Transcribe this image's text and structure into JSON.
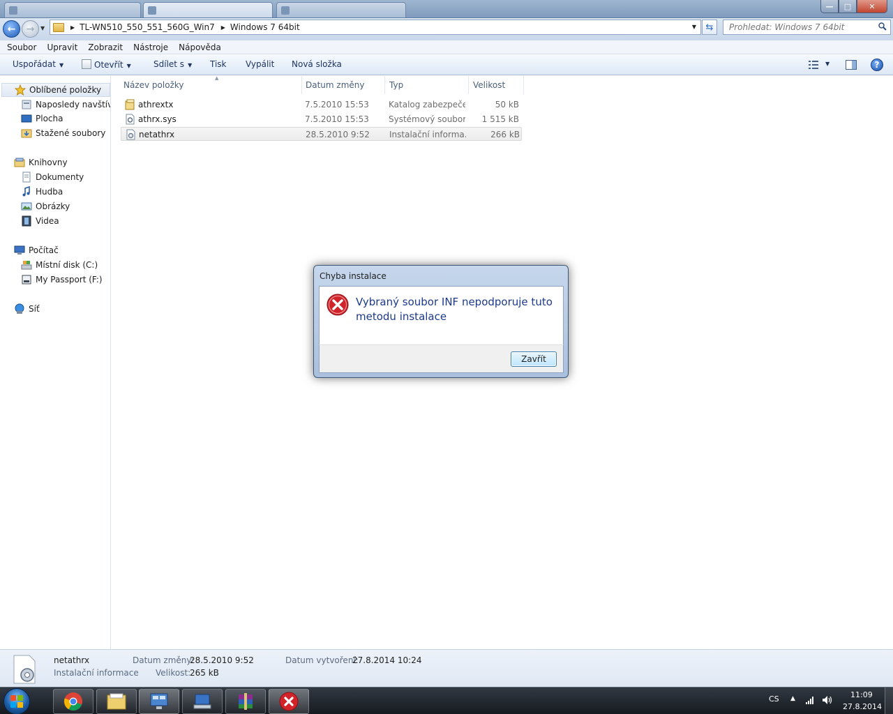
{
  "titlebar": {
    "tabs": [
      "",
      "",
      ""
    ]
  },
  "address": {
    "crumbs": [
      "TL-WN510_550_551_560G_Win7",
      "Windows 7 64bit"
    ],
    "search_placeholder": "Prohledat: Windows 7 64bit"
  },
  "menu": [
    "Soubor",
    "Upravit",
    "Zobrazit",
    "Nástroje",
    "Nápověda"
  ],
  "commands": {
    "organize": "Uspořádat",
    "open": "Otevřít",
    "share": "Sdílet s",
    "print": "Tisk",
    "burn": "Vypálit",
    "new_folder": "Nová složka"
  },
  "nav": {
    "favorites": "Oblíbené položky",
    "recent": "Naposledy navštívené",
    "desktop": "Plocha",
    "downloads": "Stažené soubory",
    "libraries": "Knihovny",
    "documents": "Dokumenty",
    "music": "Hudba",
    "pictures": "Obrázky",
    "videos": "Videa",
    "computer": "Počítač",
    "local_disk": "Místní disk (C:)",
    "passport": "My Passport (F:)",
    "network": "Síť"
  },
  "columns": {
    "name": "Název položky",
    "date": "Datum změny",
    "type": "Typ",
    "size": "Velikost"
  },
  "files": [
    {
      "name": "athrextx",
      "date": "7.5.2010 15:53",
      "type": "Katalog zabezpeče...",
      "size": "50 kB"
    },
    {
      "name": "athrx.sys",
      "date": "7.5.2010 15:53",
      "type": "Systémový soubor",
      "size": "1 515 kB"
    },
    {
      "name": "netathrx",
      "date": "28.5.2010 9:52",
      "type": "Instalační informa...",
      "size": "266 kB"
    }
  ],
  "details": {
    "name": "netathrx",
    "type": "Instalační informace",
    "modified_label": "Datum změny:",
    "modified": "28.5.2010 9:52",
    "size_label": "Velikost:",
    "size": "265 kB",
    "created_label": "Datum vytvoření:",
    "created": "27.8.2014 10:24"
  },
  "dialog": {
    "title": "Chyba instalace",
    "message": "Vybraný soubor INF nepodporuje tuto metodu instalace",
    "button": "Zavřít"
  },
  "tray": {
    "language": "CS",
    "time": "11:09",
    "date": "27.8.2014"
  },
  "colors": {
    "dialog_text": "#1c3a8c",
    "error_red": "#d1232a",
    "command_text": "#1e3560"
  }
}
